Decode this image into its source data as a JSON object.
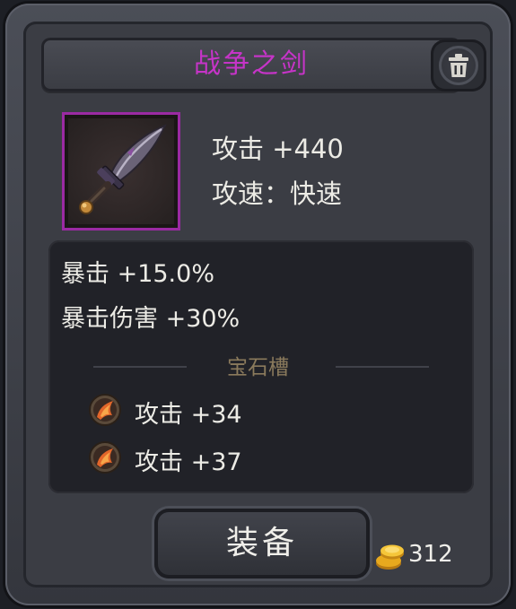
{
  "item": {
    "name": "战争之剑",
    "attack": "攻击 +440",
    "speed": "攻速：快速"
  },
  "bonus_stats": [
    {
      "label": "暴击 +15.0%"
    },
    {
      "label": "暴击伤害 +30%"
    }
  ],
  "gem_section": {
    "title": "宝石槽",
    "gems": [
      {
        "icon": "fire-gem-icon",
        "label": "攻击 +34"
      },
      {
        "icon": "fire-gem-icon",
        "label": "攻击 +37"
      }
    ]
  },
  "actions": {
    "equip_label": "装备",
    "delete_icon": "trash-icon"
  },
  "currency": {
    "icon": "gold-coin-icon",
    "amount": "312"
  },
  "colors": {
    "title": "#c634c8",
    "rarity_border": "#9b2aa3",
    "gem_title": "#8a7a5c",
    "text": "#ecebe5"
  }
}
